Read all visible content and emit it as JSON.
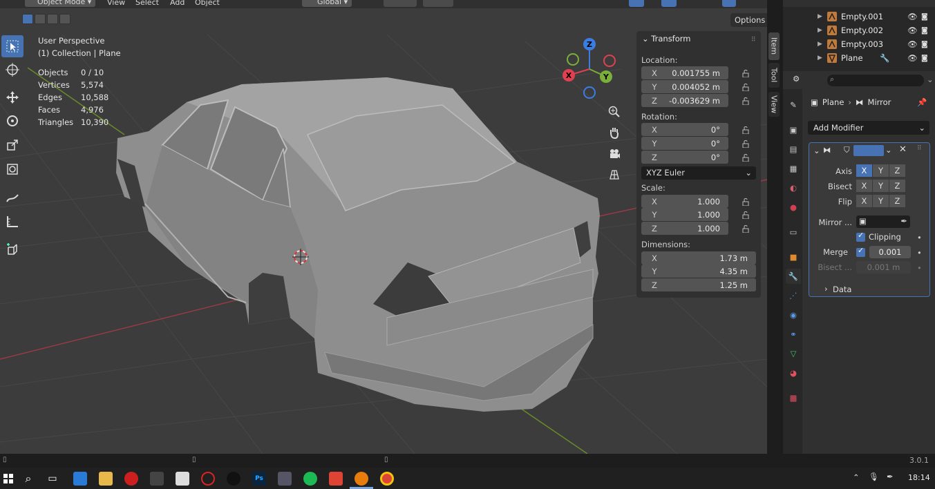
{
  "header": {
    "mode": "Object Mode",
    "menus": [
      "View",
      "Select",
      "Add",
      "Object"
    ],
    "orientation": "Global",
    "options_label": "Options"
  },
  "viewport": {
    "perspective": "User Perspective",
    "collection": "(1) Collection | Plane",
    "stats": [
      {
        "label": "Objects",
        "value": "0 / 10"
      },
      {
        "label": "Vertices",
        "value": "5,574"
      },
      {
        "label": "Edges",
        "value": "10,588"
      },
      {
        "label": "Faces",
        "value": "4,976"
      },
      {
        "label": "Triangles",
        "value": "10,390"
      }
    ],
    "gizmo": {
      "x": "X",
      "y": "Y",
      "z": "Z"
    }
  },
  "transform": {
    "title": "Transform",
    "location_label": "Location:",
    "location": [
      {
        "axis": "X",
        "value": "0.001755 m"
      },
      {
        "axis": "Y",
        "value": "0.004052 m"
      },
      {
        "axis": "Z",
        "value": "-0.003629 m"
      }
    ],
    "rotation_label": "Rotation:",
    "rotation": [
      {
        "axis": "X",
        "value": "0°"
      },
      {
        "axis": "Y",
        "value": "0°"
      },
      {
        "axis": "Z",
        "value": "0°"
      }
    ],
    "rotation_mode": "XYZ Euler",
    "scale_label": "Scale:",
    "scale": [
      {
        "axis": "X",
        "value": "1.000"
      },
      {
        "axis": "Y",
        "value": "1.000"
      },
      {
        "axis": "Z",
        "value": "1.000"
      }
    ],
    "dimensions_label": "Dimensions:",
    "dimensions": [
      {
        "axis": "X",
        "value": "1.73 m"
      },
      {
        "axis": "Y",
        "value": "4.35 m"
      },
      {
        "axis": "Z",
        "value": "1.25 m"
      }
    ]
  },
  "sidebar_tabs": [
    "Item",
    "Tool",
    "View"
  ],
  "outliner": {
    "items": [
      {
        "name": "Empty.001"
      },
      {
        "name": "Empty.002"
      },
      {
        "name": "Empty.003"
      },
      {
        "name": "Plane"
      }
    ]
  },
  "properties": {
    "breadcrumb_object": "Plane",
    "breadcrumb_modifier": "Mirror",
    "add_modifier": "Add Modifier",
    "axis_label": "Axis",
    "bisect_label": "Bisect",
    "flip_label": "Flip",
    "axes": [
      "X",
      "Y",
      "Z"
    ],
    "mirror_object_label": "Mirror ...",
    "clipping_label": "Clipping",
    "merge_label": "Merge",
    "merge_value": "0.001",
    "bisect_distance_label": "Bisect ...",
    "bisect_distance_value": "0.001 m",
    "data_label": "Data"
  },
  "status": {
    "version": "3.0.1"
  },
  "taskbar": {
    "time": "18:14",
    "ps_label": "Ps"
  }
}
